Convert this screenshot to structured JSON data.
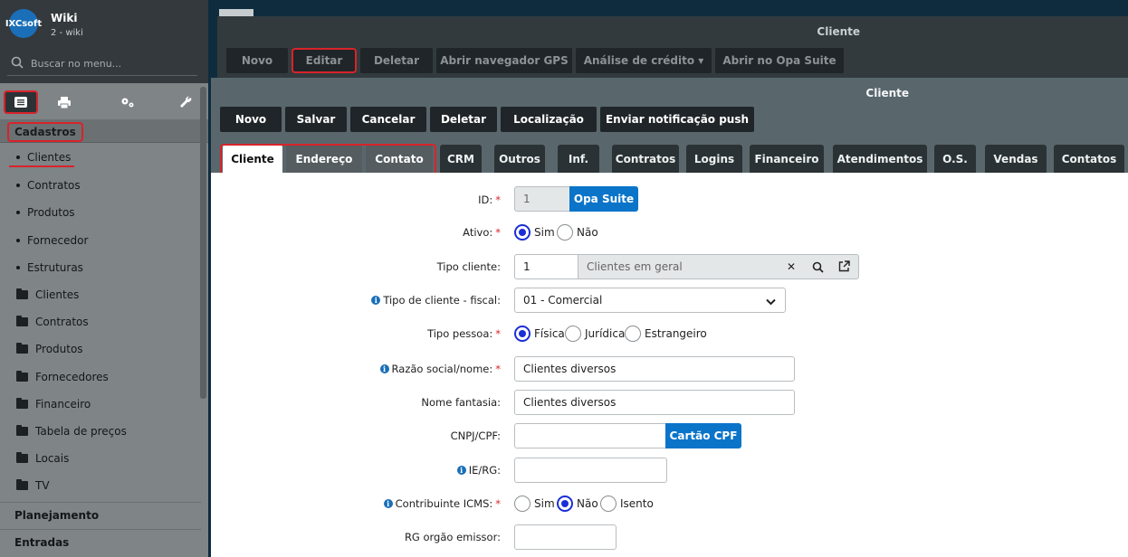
{
  "sidebar": {
    "logo": "IXCsoft",
    "title": "Wiki",
    "subtitle": "2 - wiki",
    "search_placeholder": "Buscar no menu...",
    "section": "Cadastros",
    "items": [
      {
        "label": "Clientes",
        "kind": "dot"
      },
      {
        "label": "Contratos",
        "kind": "dot"
      },
      {
        "label": "Produtos",
        "kind": "dot"
      },
      {
        "label": "Fornecedor",
        "kind": "dot"
      },
      {
        "label": "Estruturas",
        "kind": "dot"
      },
      {
        "label": "Clientes",
        "kind": "folder"
      },
      {
        "label": "Contratos",
        "kind": "folder"
      },
      {
        "label": "Produtos",
        "kind": "folder"
      },
      {
        "label": "Fornecedores",
        "kind": "folder"
      },
      {
        "label": "Financeiro",
        "kind": "folder"
      },
      {
        "label": "Tabela de preços",
        "kind": "folder"
      },
      {
        "label": "Locais",
        "kind": "folder"
      },
      {
        "label": "TV",
        "kind": "folder"
      }
    ],
    "sections_bottom": [
      "Planejamento",
      "Entradas"
    ]
  },
  "outer": {
    "title": "Cliente",
    "buttons": [
      "Novo",
      "Editar",
      "Deletar",
      "Abrir navegador GPS",
      "Análise de crédito ▾",
      "Abrir no Opa Suite"
    ]
  },
  "inner": {
    "title": "Cliente",
    "buttons": [
      "Novo",
      "Salvar",
      "Cancelar",
      "Deletar",
      "Localização",
      "Enviar notificação push"
    ],
    "tabs": [
      "Cliente",
      "Endereço",
      "Contato",
      "CRM",
      "Outros",
      "Inf.",
      "Contratos",
      "Logins",
      "Financeiro",
      "Atendimentos",
      "O.S.",
      "Vendas",
      "Contatos"
    ]
  },
  "form": {
    "id_label": "ID:",
    "id_value": "1",
    "opa_button": "Opa Suite",
    "ativo_label": "Ativo:",
    "ativo_options": [
      "Sim",
      "Não"
    ],
    "tipo_cliente_label": "Tipo cliente:",
    "tipo_cliente_code": "1",
    "tipo_cliente_desc": "Clientes em geral",
    "tipo_fiscal_label": "Tipo de cliente - fiscal:",
    "tipo_fiscal_value": "01 - Comercial",
    "tipo_pessoa_label": "Tipo pessoa:",
    "tipo_pessoa_options": [
      "Física",
      "Jurídica",
      "Estrangeiro"
    ],
    "razao_label": "Razão social/nome:",
    "razao_value": "Clientes diversos",
    "fantasia_label": "Nome fantasia:",
    "fantasia_value": "Clientes diversos",
    "cnpj_label": "CNPJ/CPF:",
    "cnpj_value": "",
    "cartao_button": "Cartão CPF",
    "ie_label": "IE/RG:",
    "ie_value": "",
    "icms_label": "Contribuinte ICMS:",
    "icms_options": [
      "Sim",
      "Não",
      "Isento"
    ],
    "rg_label": "RG orgão emissor:",
    "rg_value": ""
  },
  "colors": {
    "accent": "#0a74c9",
    "highlight": "#d8232a",
    "radio": "#1b2fd6"
  }
}
